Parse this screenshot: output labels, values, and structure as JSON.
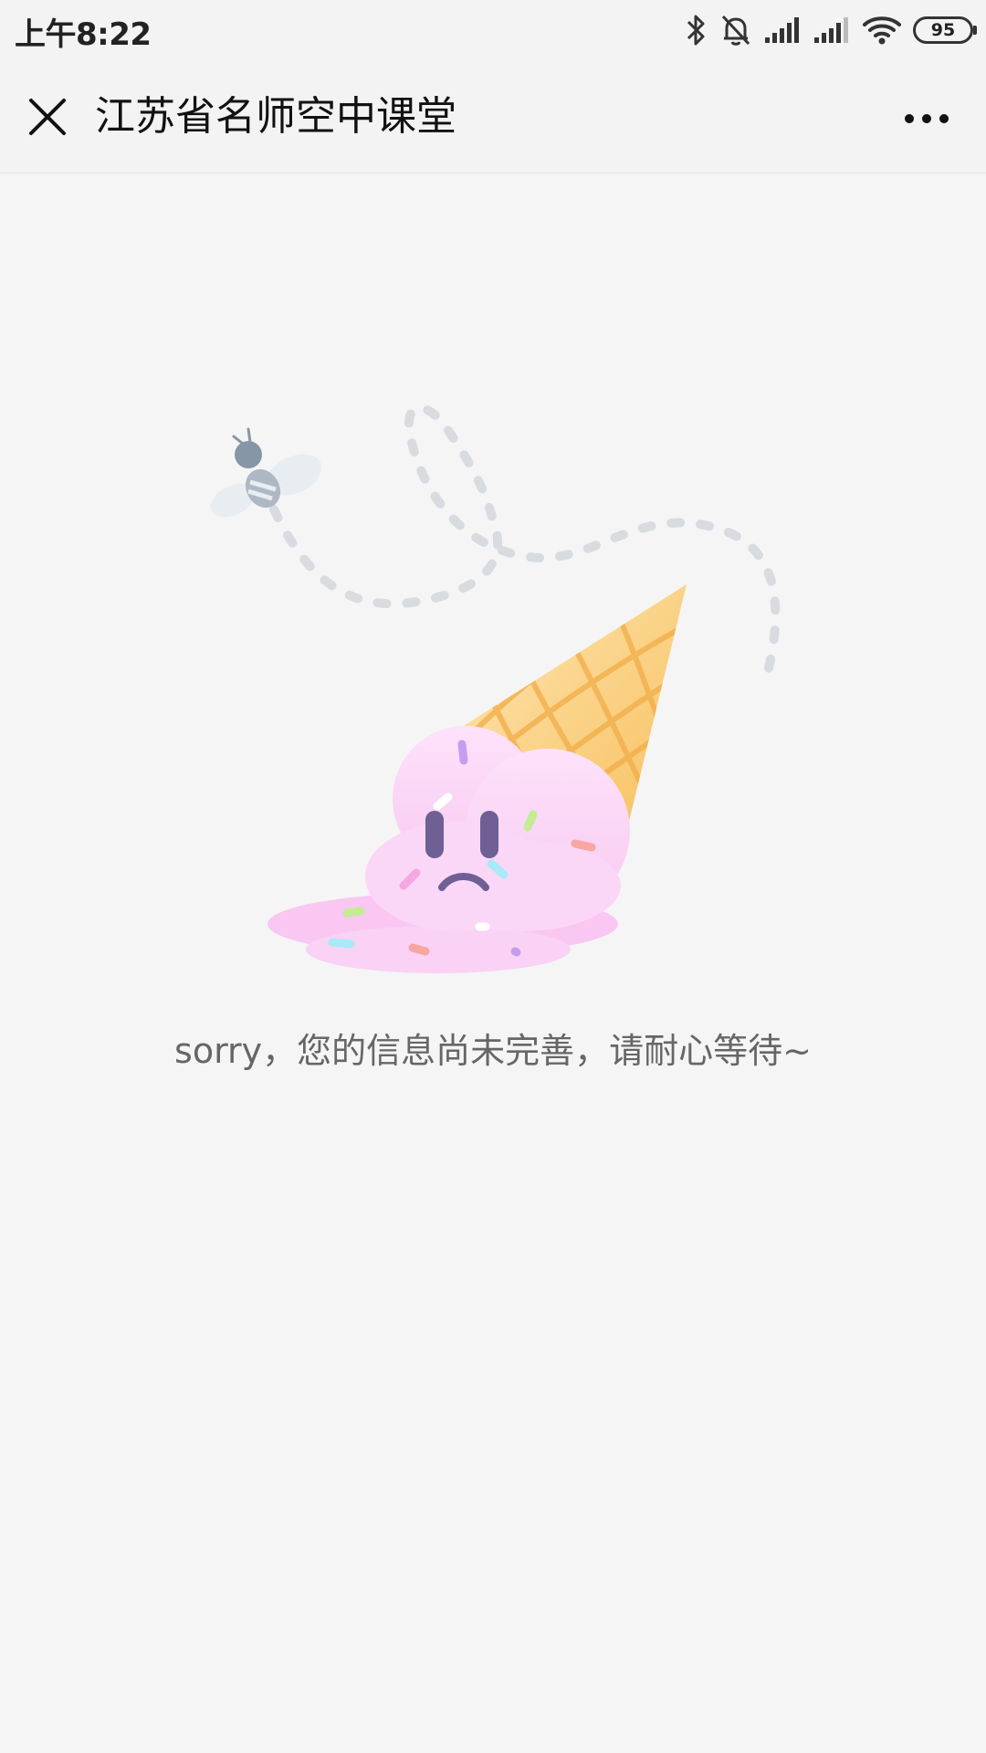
{
  "status_bar": {
    "time": "上午8:22",
    "battery_level": "95",
    "icons": [
      "bluetooth-icon",
      "mute-bell-icon",
      "signal-icon",
      "signal-icon",
      "wifi-icon",
      "battery-icon"
    ]
  },
  "nav": {
    "title": "江苏省名师空中课堂",
    "close_icon": "close-icon",
    "more_icon": "more-dots-icon"
  },
  "content": {
    "message": "sorry，您的信息尚未完善，请耐心等待~",
    "illustration": "melted-ice-cream-with-bee"
  },
  "colors": {
    "background": "#f5f5f5",
    "navbar": "#f3f3f3",
    "message_text": "#666666",
    "ice_cream_pink": "#fbd0f5",
    "cone_orange": "#f7c36a",
    "face_purple": "#6e5f94"
  }
}
